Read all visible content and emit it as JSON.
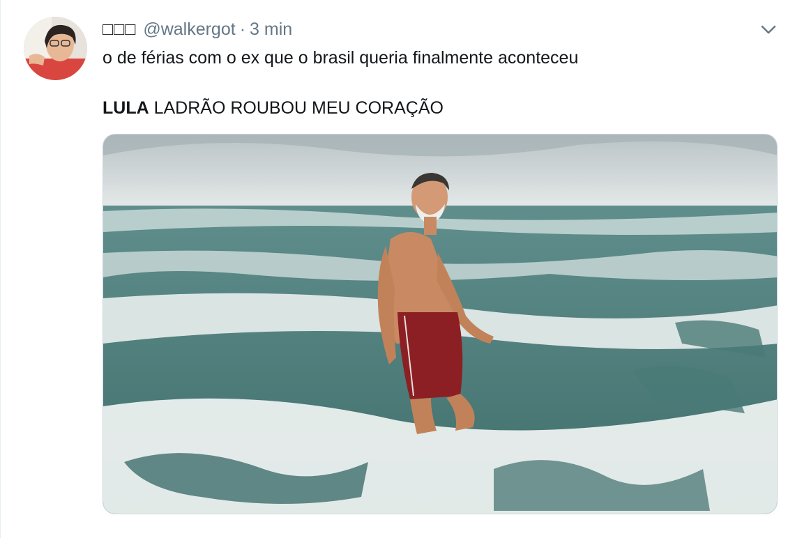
{
  "tweet": {
    "display_name": "□□□",
    "handle": "@walkergot",
    "separator": "·",
    "time": "3 min",
    "text": "o de férias com o ex que o brasil queria finalmente aconteceu",
    "text_line2_bold": "LULA",
    "text_line2_rest": " LADRÃO ROUBOU MEU CORAÇÃO"
  },
  "icons": {
    "avatar": "avatar-photo",
    "menu": "chevron-down-icon"
  },
  "colors": {
    "secondary_text": "#657786",
    "primary_text": "#14171a",
    "border": "#ccd6dd"
  }
}
